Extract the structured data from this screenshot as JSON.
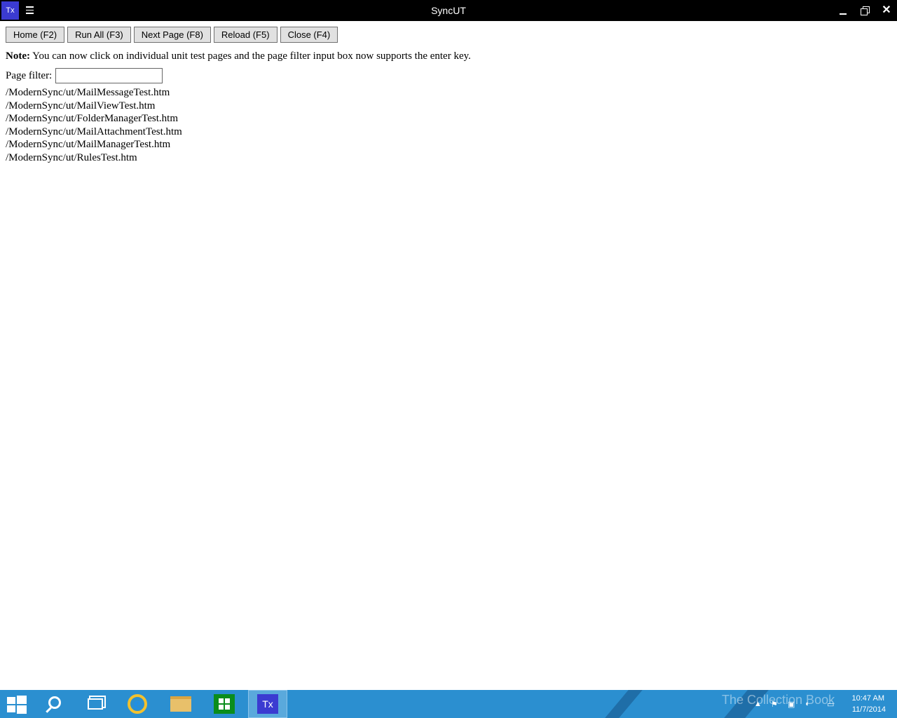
{
  "window": {
    "app_icon_label": "Tx",
    "title": "SyncUT"
  },
  "toolbar": {
    "home_label": "Home (F2)",
    "run_all_label": "Run All (F3)",
    "next_page_label": "Next Page (F8)",
    "reload_label": "Reload (F5)",
    "close_label": "Close (F4)"
  },
  "note": {
    "prefix": "Note:",
    "text": " You can now click on individual unit test pages and the page filter input box now supports the enter key."
  },
  "filter": {
    "label": "Page filter:",
    "value": "",
    "placeholder": ""
  },
  "tests": [
    "/ModernSync/ut/MailMessageTest.htm",
    "/ModernSync/ut/MailViewTest.htm",
    "/ModernSync/ut/FolderManagerTest.htm",
    "/ModernSync/ut/MailAttachmentTest.htm",
    "/ModernSync/ut/MailManagerTest.htm",
    "/ModernSync/ut/RulesTest.htm"
  ],
  "taskbar": {
    "active_app_label": "Tx",
    "ie_glyph": "e",
    "clock_time": "10:47 AM",
    "clock_date": "11/7/2014",
    "watermark": "The Collection Book"
  },
  "colors": {
    "titlebar": "#000000",
    "app_icon": "#3b3bd1",
    "taskbar": "#2b8fd0"
  }
}
